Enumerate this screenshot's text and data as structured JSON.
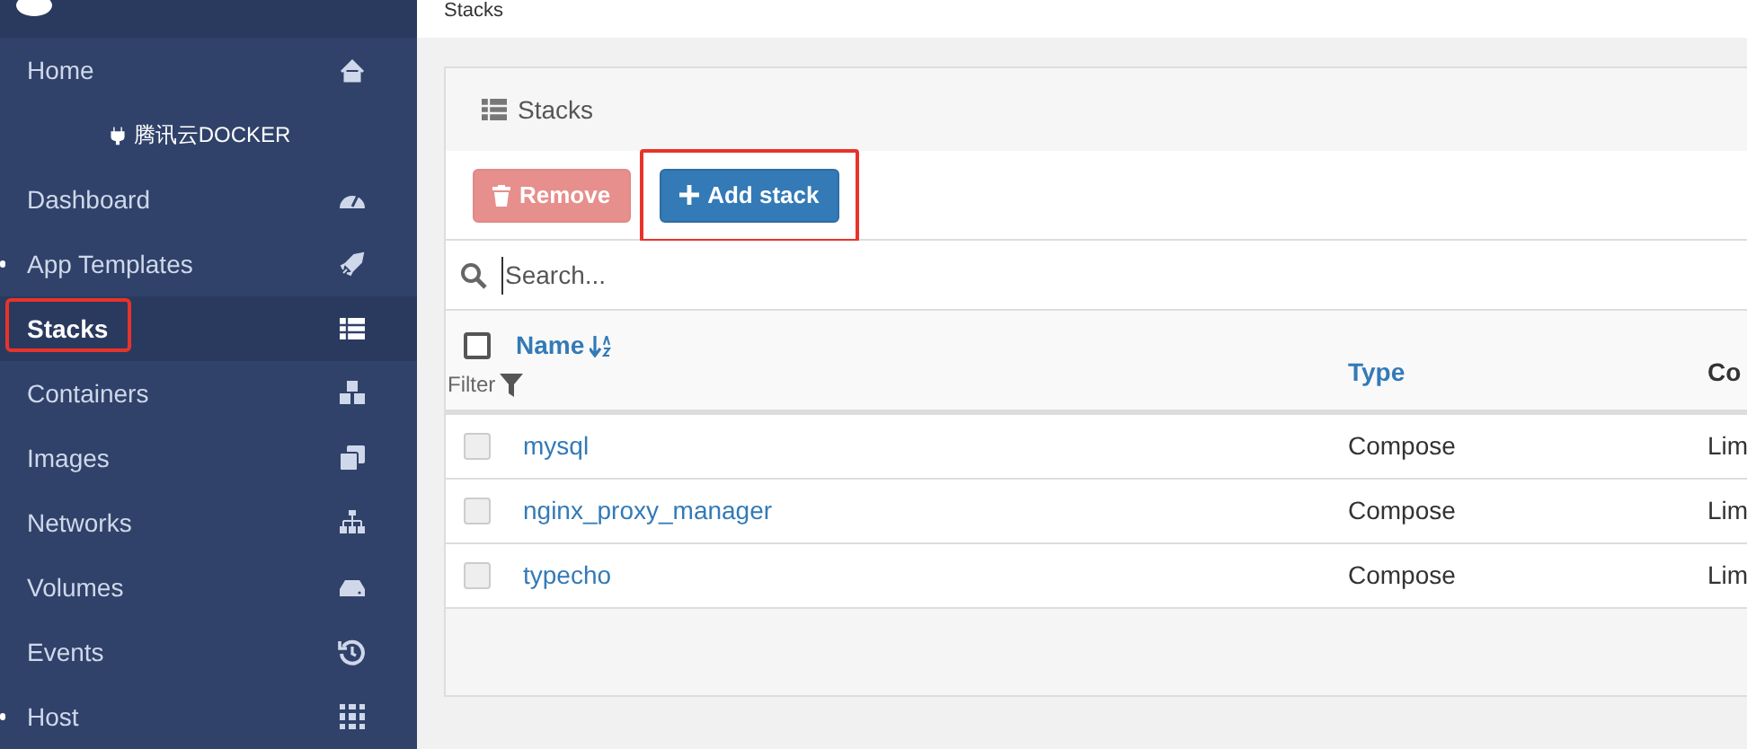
{
  "breadcrumb": "Stacks",
  "sidebar": {
    "items": [
      {
        "kind": "link",
        "label": "Home",
        "selected": false,
        "highlighted": false,
        "bullet": false
      },
      {
        "kind": "endpoint",
        "label": "腾讯云DOCKER"
      },
      {
        "kind": "link",
        "label": "Dashboard",
        "selected": false,
        "highlighted": false,
        "bullet": false
      },
      {
        "kind": "link",
        "label": "App Templates",
        "selected": false,
        "highlighted": false,
        "bullet": true
      },
      {
        "kind": "link",
        "label": "Stacks",
        "selected": true,
        "highlighted": true,
        "bullet": false
      },
      {
        "kind": "link",
        "label": "Containers",
        "selected": false,
        "highlighted": false,
        "bullet": false
      },
      {
        "kind": "link",
        "label": "Images",
        "selected": false,
        "highlighted": false,
        "bullet": false
      },
      {
        "kind": "link",
        "label": "Networks",
        "selected": false,
        "highlighted": false,
        "bullet": false
      },
      {
        "kind": "link",
        "label": "Volumes",
        "selected": false,
        "highlighted": false,
        "bullet": false
      },
      {
        "kind": "link",
        "label": "Events",
        "selected": false,
        "highlighted": false,
        "bullet": false
      },
      {
        "kind": "link",
        "label": "Host",
        "selected": false,
        "highlighted": false,
        "bullet": true
      }
    ]
  },
  "panel": {
    "title": "Stacks",
    "buttons": [
      {
        "kind": "danger",
        "label": "Remove",
        "disabled": true,
        "highlighted": false
      },
      {
        "kind": "primary",
        "label": "Add stack",
        "disabled": false,
        "highlighted": true
      }
    ],
    "search": {
      "placeholder": "Search..."
    },
    "table": {
      "select_all": {
        "checked": false
      },
      "columns": [
        {
          "label": "Name",
          "filter": "Filter"
        },
        {
          "label": "Type"
        },
        {
          "label": "Co"
        }
      ],
      "rows": [
        {
          "checked": false,
          "name": "mysql",
          "type": "Compose",
          "column_3": "Lim"
        },
        {
          "checked": false,
          "name": "nginx_proxy_manager",
          "type": "Compose",
          "column_3": "Lim"
        },
        {
          "checked": false,
          "name": "typecho",
          "type": "Compose",
          "column_3": "Lim"
        }
      ]
    }
  }
}
